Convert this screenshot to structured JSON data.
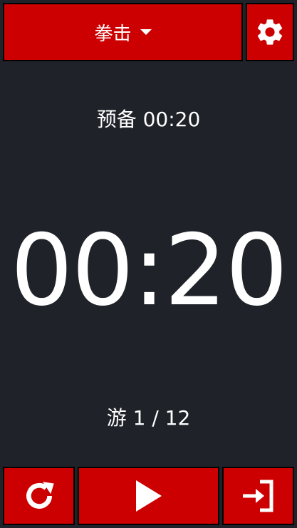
{
  "header": {
    "mode_label": "拳击"
  },
  "prep": {
    "text": "预备 00:20"
  },
  "timer": {
    "value": "00:20"
  },
  "round": {
    "text": "游 1 / 12"
  },
  "icons": {
    "settings": "gear-icon",
    "reset": "refresh-icon",
    "play": "play-icon",
    "exit": "exit-icon"
  },
  "colors": {
    "accent": "#cc0000",
    "background": "#1f2228",
    "text": "#ffffff"
  }
}
